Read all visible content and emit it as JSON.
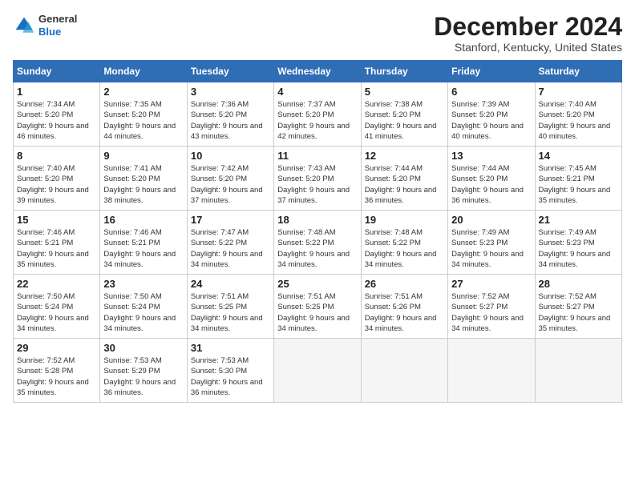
{
  "header": {
    "logo_line1": "General",
    "logo_line2": "Blue",
    "month_title": "December 2024",
    "location": "Stanford, Kentucky, United States"
  },
  "days_of_week": [
    "Sunday",
    "Monday",
    "Tuesday",
    "Wednesday",
    "Thursday",
    "Friday",
    "Saturday"
  ],
  "weeks": [
    [
      {
        "day": "1",
        "sunrise": "7:34 AM",
        "sunset": "5:20 PM",
        "daylight": "9 hours and 46 minutes."
      },
      {
        "day": "2",
        "sunrise": "7:35 AM",
        "sunset": "5:20 PM",
        "daylight": "9 hours and 44 minutes."
      },
      {
        "day": "3",
        "sunrise": "7:36 AM",
        "sunset": "5:20 PM",
        "daylight": "9 hours and 43 minutes."
      },
      {
        "day": "4",
        "sunrise": "7:37 AM",
        "sunset": "5:20 PM",
        "daylight": "9 hours and 42 minutes."
      },
      {
        "day": "5",
        "sunrise": "7:38 AM",
        "sunset": "5:20 PM",
        "daylight": "9 hours and 41 minutes."
      },
      {
        "day": "6",
        "sunrise": "7:39 AM",
        "sunset": "5:20 PM",
        "daylight": "9 hours and 40 minutes."
      },
      {
        "day": "7",
        "sunrise": "7:40 AM",
        "sunset": "5:20 PM",
        "daylight": "9 hours and 40 minutes."
      }
    ],
    [
      {
        "day": "8",
        "sunrise": "7:40 AM",
        "sunset": "5:20 PM",
        "daylight": "9 hours and 39 minutes."
      },
      {
        "day": "9",
        "sunrise": "7:41 AM",
        "sunset": "5:20 PM",
        "daylight": "9 hours and 38 minutes."
      },
      {
        "day": "10",
        "sunrise": "7:42 AM",
        "sunset": "5:20 PM",
        "daylight": "9 hours and 37 minutes."
      },
      {
        "day": "11",
        "sunrise": "7:43 AM",
        "sunset": "5:20 PM",
        "daylight": "9 hours and 37 minutes."
      },
      {
        "day": "12",
        "sunrise": "7:44 AM",
        "sunset": "5:20 PM",
        "daylight": "9 hours and 36 minutes."
      },
      {
        "day": "13",
        "sunrise": "7:44 AM",
        "sunset": "5:20 PM",
        "daylight": "9 hours and 36 minutes."
      },
      {
        "day": "14",
        "sunrise": "7:45 AM",
        "sunset": "5:21 PM",
        "daylight": "9 hours and 35 minutes."
      }
    ],
    [
      {
        "day": "15",
        "sunrise": "7:46 AM",
        "sunset": "5:21 PM",
        "daylight": "9 hours and 35 minutes."
      },
      {
        "day": "16",
        "sunrise": "7:46 AM",
        "sunset": "5:21 PM",
        "daylight": "9 hours and 34 minutes."
      },
      {
        "day": "17",
        "sunrise": "7:47 AM",
        "sunset": "5:22 PM",
        "daylight": "9 hours and 34 minutes."
      },
      {
        "day": "18",
        "sunrise": "7:48 AM",
        "sunset": "5:22 PM",
        "daylight": "9 hours and 34 minutes."
      },
      {
        "day": "19",
        "sunrise": "7:48 AM",
        "sunset": "5:22 PM",
        "daylight": "9 hours and 34 minutes."
      },
      {
        "day": "20",
        "sunrise": "7:49 AM",
        "sunset": "5:23 PM",
        "daylight": "9 hours and 34 minutes."
      },
      {
        "day": "21",
        "sunrise": "7:49 AM",
        "sunset": "5:23 PM",
        "daylight": "9 hours and 34 minutes."
      }
    ],
    [
      {
        "day": "22",
        "sunrise": "7:50 AM",
        "sunset": "5:24 PM",
        "daylight": "9 hours and 34 minutes."
      },
      {
        "day": "23",
        "sunrise": "7:50 AM",
        "sunset": "5:24 PM",
        "daylight": "9 hours and 34 minutes."
      },
      {
        "day": "24",
        "sunrise": "7:51 AM",
        "sunset": "5:25 PM",
        "daylight": "9 hours and 34 minutes."
      },
      {
        "day": "25",
        "sunrise": "7:51 AM",
        "sunset": "5:25 PM",
        "daylight": "9 hours and 34 minutes."
      },
      {
        "day": "26",
        "sunrise": "7:51 AM",
        "sunset": "5:26 PM",
        "daylight": "9 hours and 34 minutes."
      },
      {
        "day": "27",
        "sunrise": "7:52 AM",
        "sunset": "5:27 PM",
        "daylight": "9 hours and 34 minutes."
      },
      {
        "day": "28",
        "sunrise": "7:52 AM",
        "sunset": "5:27 PM",
        "daylight": "9 hours and 35 minutes."
      }
    ],
    [
      {
        "day": "29",
        "sunrise": "7:52 AM",
        "sunset": "5:28 PM",
        "daylight": "9 hours and 35 minutes."
      },
      {
        "day": "30",
        "sunrise": "7:53 AM",
        "sunset": "5:29 PM",
        "daylight": "9 hours and 36 minutes."
      },
      {
        "day": "31",
        "sunrise": "7:53 AM",
        "sunset": "5:30 PM",
        "daylight": "9 hours and 36 minutes."
      },
      null,
      null,
      null,
      null
    ]
  ]
}
